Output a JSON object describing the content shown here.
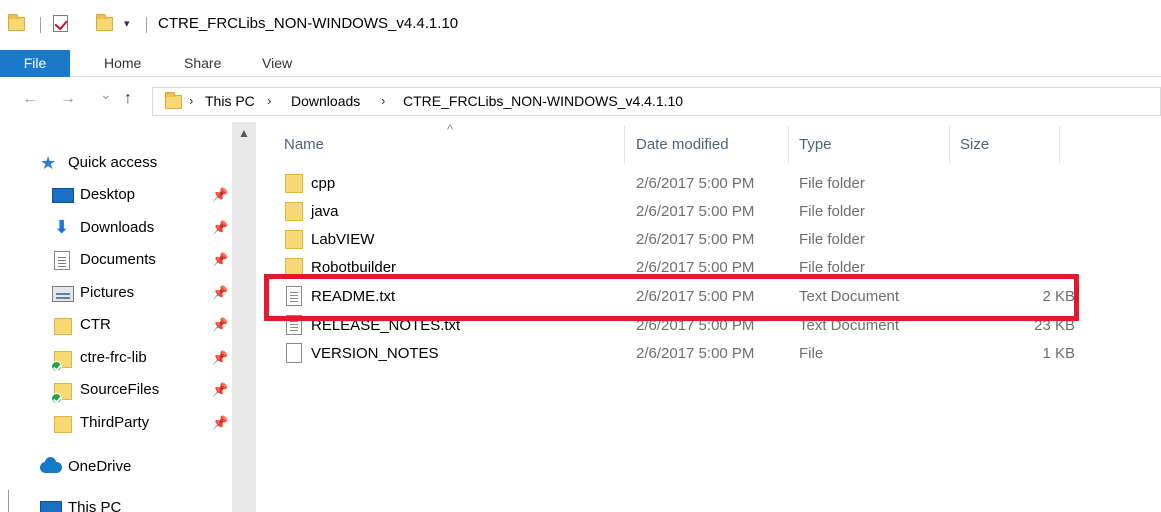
{
  "window": {
    "title": "CTRE_FRCLibs_NON-WINDOWS_v4.4.1.10",
    "qat_dropdown": "▾"
  },
  "ribbon": {
    "tabs": [
      {
        "label": "File"
      },
      {
        "label": "Home"
      },
      {
        "label": "Share"
      },
      {
        "label": "View"
      }
    ]
  },
  "address": {
    "back": "←",
    "forward": "→",
    "recent": "⌄",
    "up": "↑",
    "chevron": "›",
    "crumbs": [
      "This PC",
      "Downloads",
      "CTRE_FRCLibs_NON-WINDOWS_v4.4.1.10"
    ]
  },
  "nav_pane": {
    "scroll_up": "▲",
    "pin_glyph": "📌",
    "items": [
      {
        "label": "Quick access",
        "icon": "star-icon"
      },
      {
        "label": "Desktop",
        "icon": "desktop-icon",
        "pinned": true
      },
      {
        "label": "Downloads",
        "icon": "download-arrow-icon",
        "pinned": true
      },
      {
        "label": "Documents",
        "icon": "documents-icon",
        "pinned": true
      },
      {
        "label": "Pictures",
        "icon": "pictures-icon",
        "pinned": true
      },
      {
        "label": "CTR",
        "icon": "folder-icon",
        "pinned": true
      },
      {
        "label": "ctre-frc-lib",
        "icon": "synced-folder-icon",
        "pinned": true
      },
      {
        "label": "SourceFiles",
        "icon": "synced-folder-icon",
        "pinned": true
      },
      {
        "label": "ThirdParty",
        "icon": "folder-icon",
        "pinned": true
      },
      {
        "label": "OneDrive",
        "icon": "onedrive-cloud-icon"
      },
      {
        "label": "This PC",
        "icon": "this-pc-icon"
      }
    ]
  },
  "file_list": {
    "sort_indicator": "^",
    "columns": {
      "name": "Name",
      "date": "Date modified",
      "type": "Type",
      "size": "Size"
    },
    "rows": [
      {
        "name": "cpp",
        "date": "2/6/2017 5:00 PM",
        "type": "File folder",
        "size": "",
        "icon": "folder"
      },
      {
        "name": "java",
        "date": "2/6/2017 5:00 PM",
        "type": "File folder",
        "size": "",
        "icon": "folder"
      },
      {
        "name": "LabVIEW",
        "date": "2/6/2017 5:00 PM",
        "type": "File folder",
        "size": "",
        "icon": "folder"
      },
      {
        "name": "Robotbuilder",
        "date": "2/6/2017 5:00 PM",
        "type": "File folder",
        "size": "",
        "icon": "folder"
      },
      {
        "name": "README.txt",
        "date": "2/6/2017 5:00 PM",
        "type": "Text Document",
        "size": "2 KB",
        "icon": "text"
      },
      {
        "name": "RELEASE_NOTES.txt",
        "date": "2/6/2017 5:00 PM",
        "type": "Text Document",
        "size": "23 KB",
        "icon": "text"
      },
      {
        "name": "VERSION_NOTES",
        "date": "2/6/2017 5:00 PM",
        "type": "File",
        "size": "1 KB",
        "icon": "blank"
      }
    ]
  },
  "colors": {
    "file_tab": "#1979ca",
    "highlight": "#e3182d",
    "folder": "#f8d775"
  }
}
